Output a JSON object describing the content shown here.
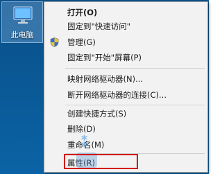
{
  "desktop": {
    "icon_label": "此电脑",
    "icon": "computer-icon"
  },
  "context_menu": {
    "items": [
      {
        "label": "打开(O)",
        "bold": true,
        "icon": ""
      },
      {
        "label": "固定到\"快速访问\"",
        "icon": ""
      },
      {
        "label": "管理(G)",
        "icon": "uac-shield-icon"
      },
      {
        "label": "固定到\"开始\"屏幕(P)",
        "icon": ""
      },
      {
        "label": "映射网络驱动器(N)...",
        "icon": ""
      },
      {
        "label": "断开网络驱动器的连接(C)...",
        "icon": ""
      },
      {
        "label": "创建快捷方式(S)",
        "icon": ""
      },
      {
        "label": "删除(D)",
        "icon": ""
      },
      {
        "label": "重命名(M)",
        "icon": ""
      },
      {
        "label": "属性(R)",
        "icon": ""
      }
    ]
  },
  "annotation": {
    "highlight_color": "#d41414",
    "highlighted_item": "属性(R)"
  },
  "colors": {
    "desktop_bg": "#0a5a98",
    "menu_bg": "#f2f2f2"
  }
}
